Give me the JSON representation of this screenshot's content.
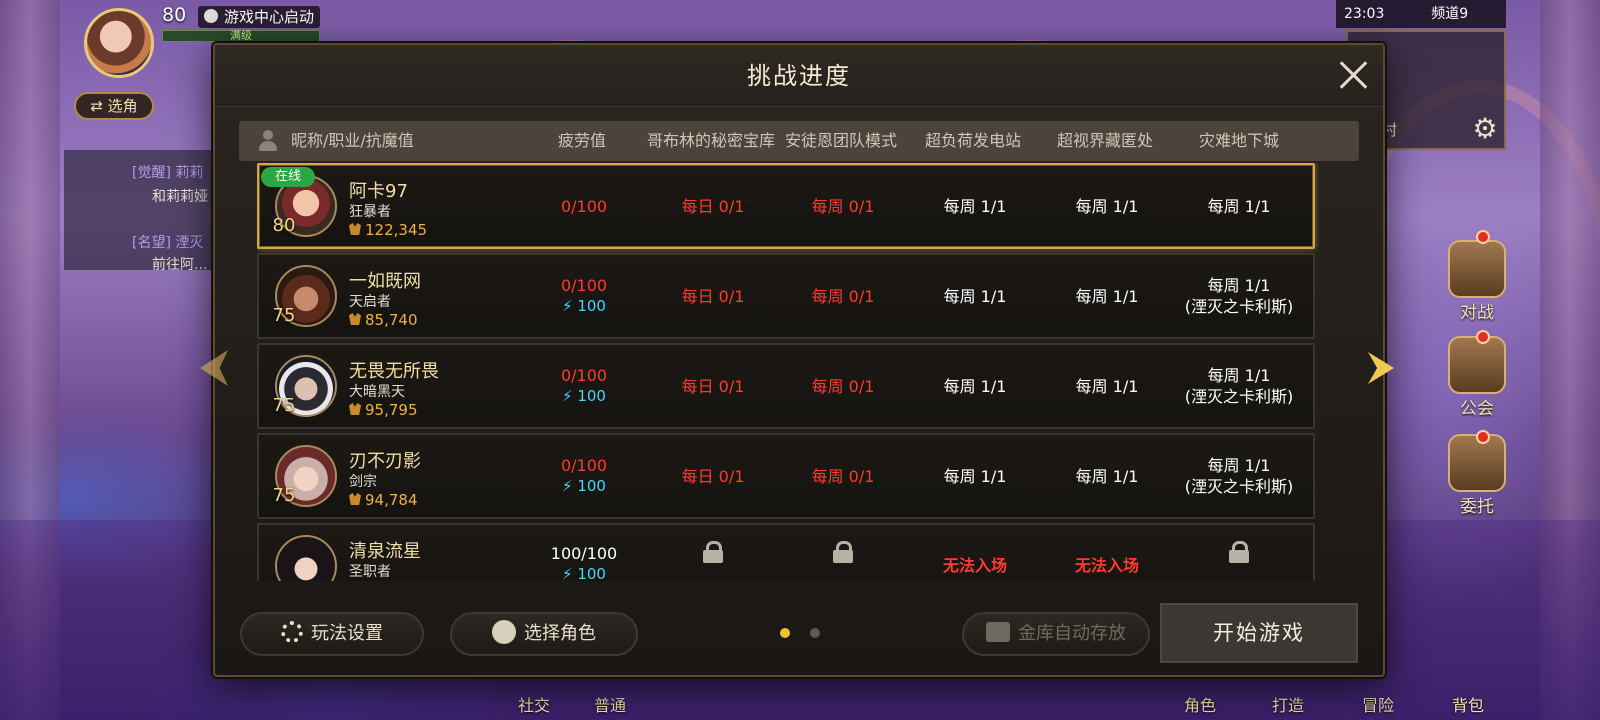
{
  "hud": {
    "level": "80",
    "title": "游戏中心启动",
    "level_status": "满级",
    "switch_label": "⇄ 选角",
    "chat": [
      {
        "tag": "[觉醒]",
        "name": "莉莉",
        "sub": "和莉莉娅"
      },
      {
        "tag": "[名望]",
        "name": "湮灭",
        "sub": "前往阿..."
      }
    ],
    "time": "23:03",
    "channel": "频道9",
    "minimap_label": "者之村",
    "side_buttons": [
      "对战",
      "公会",
      "委托"
    ],
    "bottom_menu": [
      "社交",
      "普通",
      "角色",
      "打造",
      "冒险",
      "背包"
    ]
  },
  "dialog": {
    "title": "挑战进度",
    "columns": [
      "昵称/职业/抗魔值",
      "疲劳值",
      "哥布林的秘密宝库",
      "安徒恩团队模式",
      "超负荷发电站",
      "超视界藏匿处",
      "灾难地下城"
    ],
    "rows": [
      {
        "online": "在线",
        "name": "阿卡97",
        "class": "狂暴者",
        "power": "122,345",
        "level": "80",
        "fatigue": "0/100",
        "fatigue_bonus": "",
        "goblin": "每日 0/1",
        "anton": "每周 0/1",
        "overload": "每周 1/1",
        "hypervision": "每周 1/1",
        "disaster": "每周 1/1",
        "disaster_sub": ""
      },
      {
        "online": "",
        "name": "一如既网",
        "class": "天启者",
        "power": "85,740",
        "level": "75",
        "fatigue": "0/100",
        "fatigue_bonus": "⚡ 100",
        "goblin": "每日 0/1",
        "anton": "每周 0/1",
        "overload": "每周 1/1",
        "hypervision": "每周 1/1",
        "disaster": "每周 1/1",
        "disaster_sub": "(湮灭之卡利斯)"
      },
      {
        "online": "",
        "name": "无畏无所畏",
        "class": "大暗黑天",
        "power": "95,795",
        "level": "75",
        "fatigue": "0/100",
        "fatigue_bonus": "⚡ 100",
        "goblin": "每日 0/1",
        "anton": "每周 0/1",
        "overload": "每周 1/1",
        "hypervision": "每周 1/1",
        "disaster": "每周 1/1",
        "disaster_sub": "(湮灭之卡利斯)"
      },
      {
        "online": "",
        "name": "刃不刃影",
        "class": "剑宗",
        "power": "94,784",
        "level": "75",
        "fatigue": "0/100",
        "fatigue_bonus": "⚡ 100",
        "goblin": "每日 0/1",
        "anton": "每周 0/1",
        "overload": "每周 1/1",
        "hypervision": "每周 1/1",
        "disaster": "每周 1/1",
        "disaster_sub": "(湮灭之卡利斯)"
      },
      {
        "online": "",
        "name": "清泉流星",
        "class": "圣职者",
        "power": "",
        "level": "",
        "fatigue": "100/100",
        "fatigue_bonus": "⚡ 100",
        "goblin": "",
        "anton": "",
        "overload": "无法入场",
        "hypervision": "无法入场",
        "disaster": "",
        "disaster_sub": ""
      }
    ],
    "footer": {
      "settings": "玩法设置",
      "choose_role": "选择角色",
      "auto_store": "金库自动存放",
      "start": "开始游戏"
    },
    "pages": {
      "current": 1,
      "total": 2
    }
  },
  "colors": {
    "accent_gold": "#d2a84a",
    "red_text": "#ff3a30",
    "fatigue_bonus": "#42d8ff",
    "online_green": "#2aa844"
  }
}
